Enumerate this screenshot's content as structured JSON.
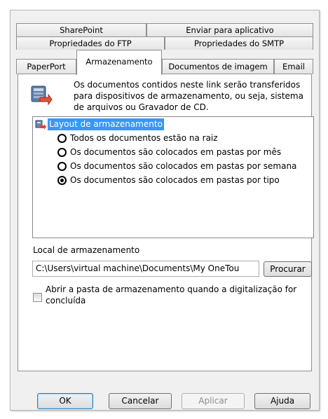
{
  "tabs": {
    "row1": [
      "SharePoint",
      "Enviar para aplicativo"
    ],
    "row2": [
      "Propriedades do FTP",
      "Propriedades do SMTP"
    ],
    "row3": [
      "PaperPort",
      "Armazenamento",
      "Documentos de imagem",
      "Email"
    ],
    "active": "Armazenamento"
  },
  "description": "Os documentos contidos neste link serão transferidos para dispositivos de armazenamento, ou seja, sistema de arquivos ou Gravador de CD.",
  "layout": {
    "root_label": "Layout de armazenamento",
    "options": [
      {
        "label": "Todos os documentos estão na raiz",
        "checked": false
      },
      {
        "label": "Os documentos são colocados em pastas por mês",
        "checked": false
      },
      {
        "label": "Os documentos são colocados em pastas por semana",
        "checked": false
      },
      {
        "label": "Os documentos são colocados em pastas por tipo",
        "checked": true
      }
    ]
  },
  "storage": {
    "label": "Local de armazenamento",
    "path": "C:\\Users\\virtual machine\\Documents\\My OneTou",
    "browse_label": "Procurar"
  },
  "open_folder": {
    "label": "Abrir a pasta de armazenamento quando a digitalização for concluída",
    "checked": false
  },
  "buttons": {
    "ok": "OK",
    "cancel": "Cancelar",
    "apply": "Aplicar",
    "help": "Ajuda"
  },
  "icons": {
    "storage": "storage-transfer-icon",
    "layout": "layout-tree-icon"
  }
}
